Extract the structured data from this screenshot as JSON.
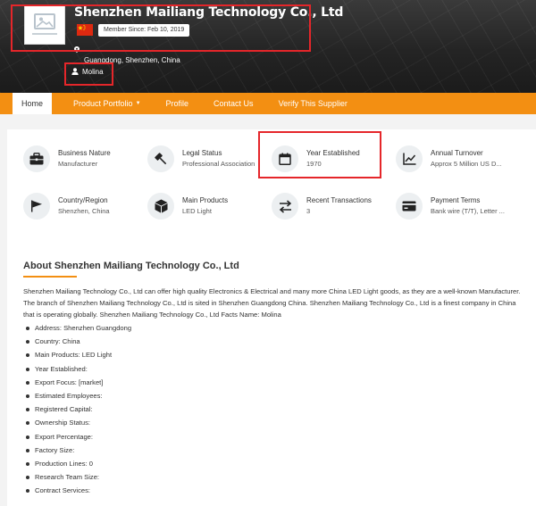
{
  "header": {
    "company_name": "Shenzhen Mailiang Technology Co., Ltd",
    "member_since": "Member Since: Feb 10, 2019",
    "location": "Guangdong, Shenzhen, China",
    "contact_name": "Molina",
    "flag_icon": "china-flag-icon",
    "logo_icon": "image-placeholder-icon"
  },
  "nav": {
    "items": [
      {
        "label": "Home",
        "active": true
      },
      {
        "label": "Product Portfolio",
        "dropdown": true
      },
      {
        "label": "Profile"
      },
      {
        "label": "Contact Us"
      },
      {
        "label": "Verify This Supplier"
      }
    ]
  },
  "company_info": [
    {
      "label": "Business Nature",
      "value": "Manufacturer",
      "icon": "briefcase-icon"
    },
    {
      "label": "Legal Status",
      "value": "Professional Association",
      "icon": "gavel-icon"
    },
    {
      "label": "Year Established",
      "value": "1970",
      "icon": "calendar-icon"
    },
    {
      "label": "Annual Turnover",
      "value": "Approx 5 Million US D...",
      "icon": "chart-line-icon"
    },
    {
      "label": "Country/Region",
      "value": "Shenzhen, China",
      "icon": "flag-icon"
    },
    {
      "label": "Main Products",
      "value": "LED Light",
      "icon": "cube-icon"
    },
    {
      "label": "Recent Transactions",
      "value": "3",
      "icon": "exchange-icon"
    },
    {
      "label": "Payment Terms",
      "value": "Bank wire (T/T), Letter ...",
      "icon": "credit-card-icon"
    }
  ],
  "about": {
    "title": "About Shenzhen Mailiang Technology Co., Ltd",
    "description": "Shenzhen Mailiang Technology Co., Ltd can offer high quality Electronics & Electrical and many more China LED Light goods, as they are a well-known Manufacturer. The branch of Shenzhen Mailiang Technology Co., Ltd is sited in Shenzhen Guangdong China. Shenzhen Mailiang Technology Co., Ltd is a finest company in China that is operating globally. Shenzhen Mailiang Technology Co., Ltd Facts Name: Molina",
    "facts": [
      "Address: Shenzhen Guangdong",
      "Country: China",
      "Main Products: LED Light",
      "Year Established:",
      "Export Focus: [market]",
      "Estimated Employees:",
      "Registered Capital:",
      "Ownership Status:",
      "Export Percentage:",
      "Factory Size:",
      "Production Lines: 0",
      "Research Team Size:",
      "Contract Services:"
    ]
  },
  "colors": {
    "accent": "#f38f12",
    "highlight": "#e5262a"
  }
}
